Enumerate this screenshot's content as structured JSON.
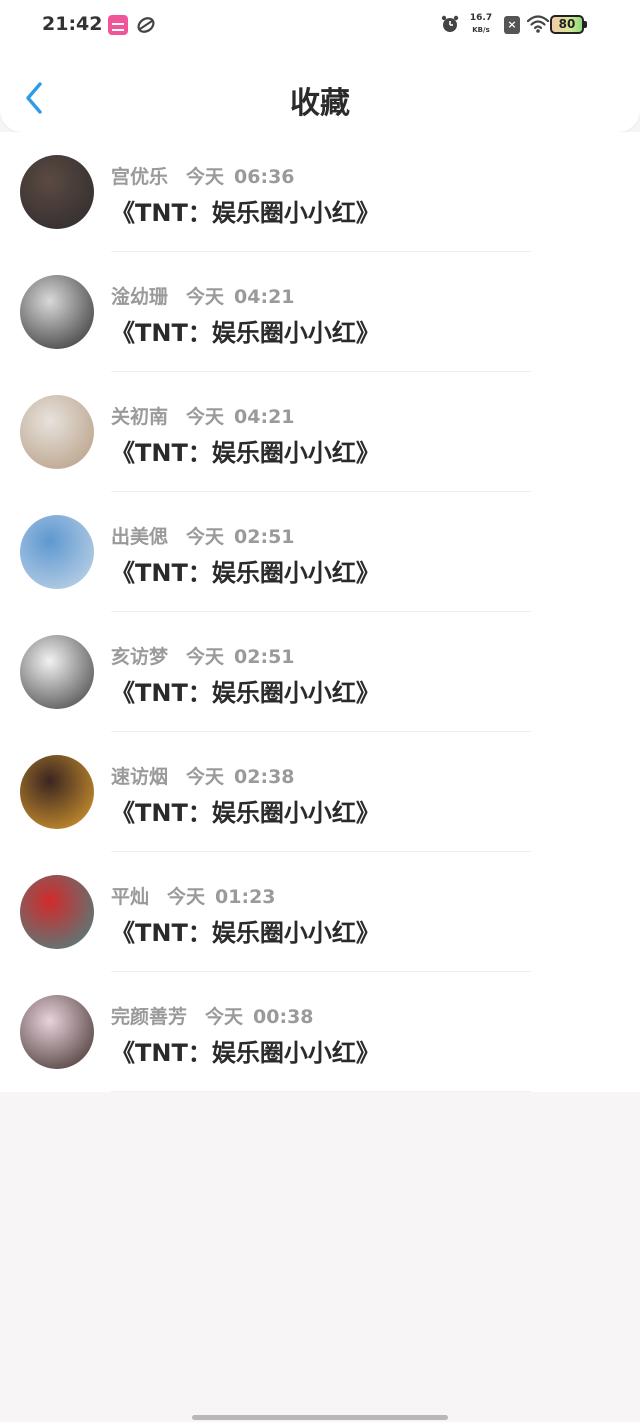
{
  "status_bar": {
    "time": "21:42",
    "speed_value": "16.7",
    "speed_unit": "KB/s",
    "battery": "80"
  },
  "nav": {
    "title": "收藏"
  },
  "items": [
    {
      "name": "宫优乐",
      "day": "今天",
      "time": "06:36",
      "message": "《TNT：娱乐圈小小红》",
      "avatar_colors": [
        "#5b4a42",
        "#2c2a2c"
      ]
    },
    {
      "name": "淦幼珊",
      "day": "今天",
      "time": "04:21",
      "message": "《TNT：娱乐圈小小红》",
      "avatar_colors": [
        "#d9d9d9",
        "#2a2a2a"
      ]
    },
    {
      "name": "关初南",
      "day": "今天",
      "time": "04:21",
      "message": "《TNT：娱乐圈小小红》",
      "avatar_colors": [
        "#e7e2dc",
        "#b49a80"
      ]
    },
    {
      "name": "出美偲",
      "day": "今天",
      "time": "02:51",
      "message": "《TNT：娱乐圈小小红》",
      "avatar_colors": [
        "#5d98d0",
        "#c8d8e8"
      ]
    },
    {
      "name": "亥访梦",
      "day": "今天",
      "time": "02:51",
      "message": "《TNT：娱乐圈小小红》",
      "avatar_colors": [
        "#f2f2f2",
        "#3a3a3a"
      ]
    },
    {
      "name": "速访烟",
      "day": "今天",
      "time": "02:38",
      "message": "《TNT：娱乐圈小小红》",
      "avatar_colors": [
        "#3a2520",
        "#e0a030"
      ]
    },
    {
      "name": "平灿",
      "day": "今天",
      "time": "01:23",
      "message": "《TNT：娱乐圈小小红》",
      "avatar_colors": [
        "#d32a2a",
        "#3f8a8a"
      ]
    },
    {
      "name": "完颜善芳",
      "day": "今天",
      "time": "00:38",
      "message": "《TNT：娱乐圈小小红》",
      "avatar_colors": [
        "#e8d2dc",
        "#3a2a24"
      ]
    }
  ],
  "colors": {
    "accent": "#2e9be8",
    "meta_text": "#9a9a9a",
    "message_text": "#2a2a2a"
  }
}
